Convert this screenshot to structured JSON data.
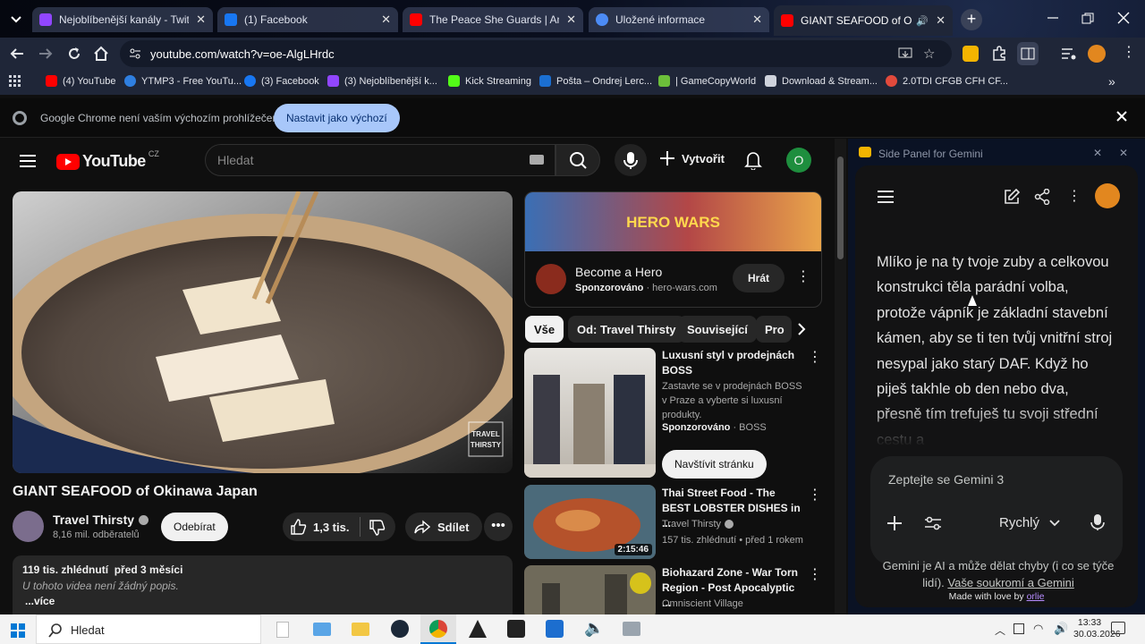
{
  "tabs": [
    {
      "title": "Nejoblíbenější kanály - Twitch",
      "color": "#9146ff"
    },
    {
      "title": "(1) Facebook",
      "color": "#1877f2"
    },
    {
      "title": "The Peace She Guards | Ambient",
      "color": "#ff0000"
    },
    {
      "title": "Uložené informace",
      "color": "#4c8bf5"
    },
    {
      "title": "GIANT SEAFOOD of Okinawa",
      "color": "#ff0000"
    }
  ],
  "address": {
    "url": "youtube.com/watch?v=oe-AlgLHrdc"
  },
  "bookmarks": [
    {
      "label": "(4) YouTube"
    },
    {
      "label": "YTMP3 - Free YouTu..."
    },
    {
      "label": "(3) Facebook"
    },
    {
      "label": "(3) Nejoblíbenější k..."
    },
    {
      "label": "Kick Streaming"
    },
    {
      "label": "Pošta – Ondrej Lerc..."
    },
    {
      "label": "| GameCopyWorld"
    },
    {
      "label": "Download & Stream..."
    },
    {
      "label": "2.0TDI CFGB CFH CF..."
    }
  ],
  "infobar": {
    "message": "Google Chrome není vaším výchozím prohlížečem",
    "button": "Nastavit jako výchozí"
  },
  "youtube": {
    "logo": "YouTube",
    "country": "CZ",
    "search_placeholder": "Hledat",
    "create_label": "Vytvořit",
    "avatar_letter": "O",
    "video_title": "GIANT SEAFOOD of Okinawa Japan",
    "channel": "Travel Thirsty",
    "subscribers": "8,16 mil. odběratelů",
    "subscribe_label": "Odebírat",
    "likes": "1,3 tis.",
    "share_label": "Sdílet",
    "views_date": "119 tis. zhlédnutí  před 3 měsíci",
    "description": "U tohoto videa není žádný popis.",
    "more": "...více",
    "watermark": "TRAVEL THIRSTY",
    "ad": {
      "title": "Become a Hero",
      "sponsored": "Sponzorováno",
      "domain": "hero-wars.com",
      "button": "Hrát",
      "banner": "HERO WARS"
    },
    "chips": [
      "Vše",
      "Od: Travel Thirsty",
      "Související",
      "Pro"
    ],
    "boss_ad": {
      "title": "Luxusní styl v prodejnách BOSS",
      "desc": "Zastavte se v prodejnách BOSS v Praze a vyberte si luxusní produkty.",
      "sponsored": "Sponzorováno",
      "brand": "BOSS",
      "button": "Navštívit stránku"
    },
    "recs": [
      {
        "title": "Thai Street Food - The BEST LOBSTER DISHES in ...",
        "channel": "Travel Thirsty",
        "meta": "157 tis. zhlédnutí • před 1 rokem",
        "duration": "2:15:46"
      },
      {
        "title": "Biohazard Zone - War Torn Region - Post Apocalyptic ...",
        "channel": "Omniscient Village",
        "meta": "",
        "duration": ""
      }
    ]
  },
  "gemini": {
    "panel_title": "Side Panel for Gemini",
    "response": "Mlíko je na ty tvoje zuby a celkovou konstrukci těla parádní volba, protože vápník je základní stavební kámen, aby se ti ten tvůj vnitřní stroj nesypal jako starý DAF. Když ho piješ takhle ob den nebo dva, přesně tím trefuješ tu svoji střední cestu a",
    "input_placeholder": "Zeptejte se Gemini 3",
    "mode": "Rychlý",
    "disclaimer": "Gemini je AI a může dělat chyby (i co se týče lidí).",
    "privacy_link": "Vaše soukromí a Gemini",
    "made_with": "Made with love by",
    "made_by": "orlie"
  },
  "taskbar": {
    "search": "Hledat",
    "time": "13:33",
    "date": "30.03.2026"
  }
}
